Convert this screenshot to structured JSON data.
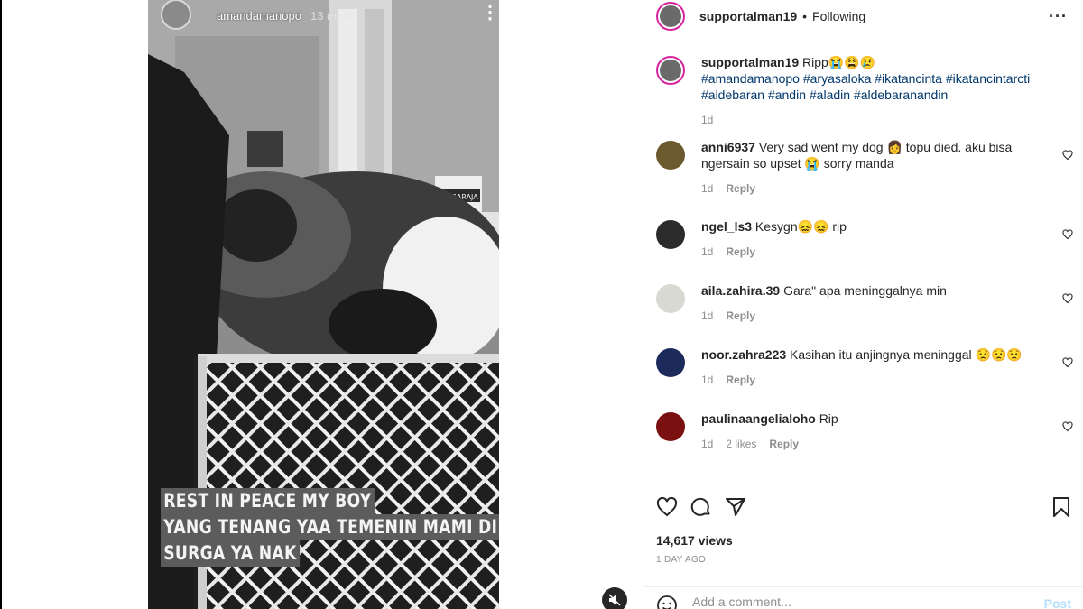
{
  "story": {
    "username": "amandamanopo",
    "time": "13 menit",
    "caption_lines": [
      "REST IN PEACE MY BOY",
      "YANG TENANG YAA TEMENIN MAMI DI",
      "SURGA YA NAK"
    ],
    "box_label": "SINGARAJA"
  },
  "post_header": {
    "username": "supportalman19",
    "dot": "•",
    "follow_status": "Following"
  },
  "post_caption": {
    "username": "supportalman19",
    "text": "Ripp😭😩😢",
    "hashtags": "#amandamanopo #aryasaloka #ikatancinta #ikatancintarcti #aldebaran #andin #aladin #aldebaranandin",
    "time": "1d"
  },
  "comments": [
    {
      "username": "anni6937",
      "text": "Very sad went my dog 👩 topu died. aku bisa ngersain so upset 😭 sorry manda",
      "time": "1d",
      "likes": "",
      "reply": "Reply",
      "avatar_color": "#6b5a2e"
    },
    {
      "username": "ngel_ls3",
      "text": "Kesygn😖😖 rip",
      "time": "1d",
      "likes": "",
      "reply": "Reply",
      "avatar_color": "#2b2b2b"
    },
    {
      "username": "aila.zahira.39",
      "text": "Gara\" apa meninggalnya min",
      "time": "1d",
      "likes": "",
      "reply": "Reply",
      "avatar_color": "#d9d9d4"
    },
    {
      "username": "noor.zahra223",
      "text": "Kasihan itu anjingnya meninggal 😟😟😟",
      "time": "1d",
      "likes": "",
      "reply": "Reply",
      "avatar_color": "#1d2a5c"
    },
    {
      "username": "paulinaangelialoho",
      "text": "Rip",
      "time": "1d",
      "likes": "2 likes",
      "reply": "Reply",
      "avatar_color": "#7a1010"
    }
  ],
  "stats": {
    "views": "14,617 views",
    "posted": "1 DAY AGO"
  },
  "composer": {
    "placeholder": "Add a comment...",
    "post_label": "Post"
  },
  "icons": {
    "like": "heart-icon",
    "comment": "comment-icon",
    "share": "paper-plane-icon",
    "save": "bookmark-icon",
    "emoji": "smiley-icon",
    "mute": "muted-speaker-icon",
    "more": "more-icon"
  },
  "colors": {
    "link": "#00376b",
    "muted": "#8e8e8e",
    "story_ring": "#d6249f",
    "post_disabled": "#b2dffc"
  }
}
